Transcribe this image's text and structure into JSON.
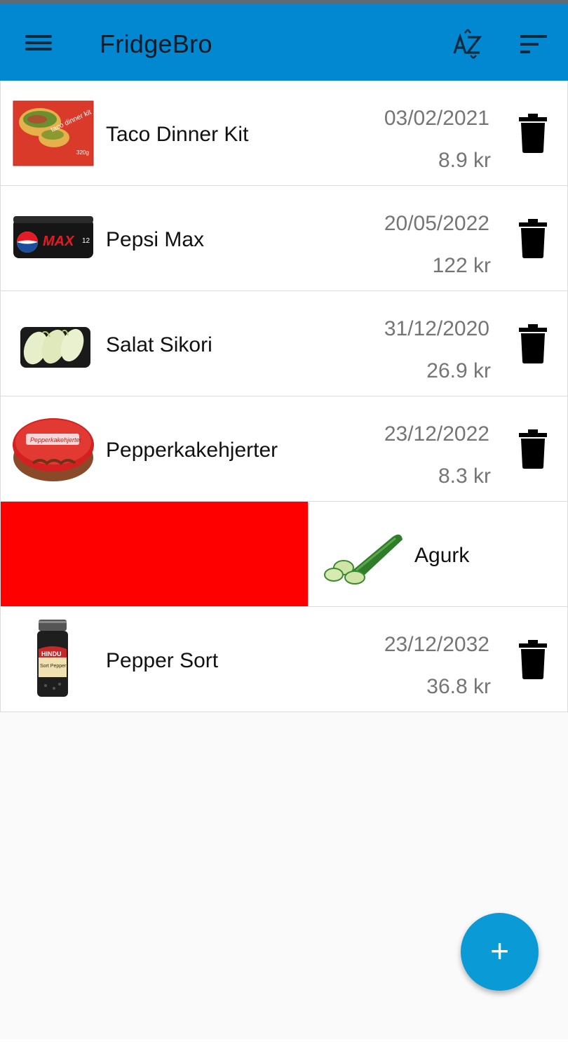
{
  "app": {
    "title": "FridgeBro",
    "colors": {
      "app_bar": "#0288d1",
      "fab": "#0a9bd6",
      "swipe_delete_bg": "#ff0000"
    },
    "icons": {
      "menu": "menu-icon",
      "sort_alpha": "sort-alphabetical-icon",
      "sort": "sort-icon",
      "delete": "trash-icon",
      "add": "plus-icon"
    }
  },
  "items": [
    {
      "name": "Taco Dinner Kit",
      "date": "03/02/2021",
      "price": "8.9 kr"
    },
    {
      "name": "Pepsi Max",
      "date": "20/05/2022",
      "price": "122 kr"
    },
    {
      "name": "Salat Sikori",
      "date": "31/12/2020",
      "price": "26.9 kr"
    },
    {
      "name": "Pepperkakehjerter",
      "date": "23/12/2022",
      "price": "8.3 kr"
    }
  ],
  "swiped_item": {
    "name": "Agurk"
  },
  "last_item": {
    "name": "Pepper Sort",
    "date": "23/12/2032",
    "price": "36.8 kr"
  },
  "fab": {
    "label": "+"
  }
}
